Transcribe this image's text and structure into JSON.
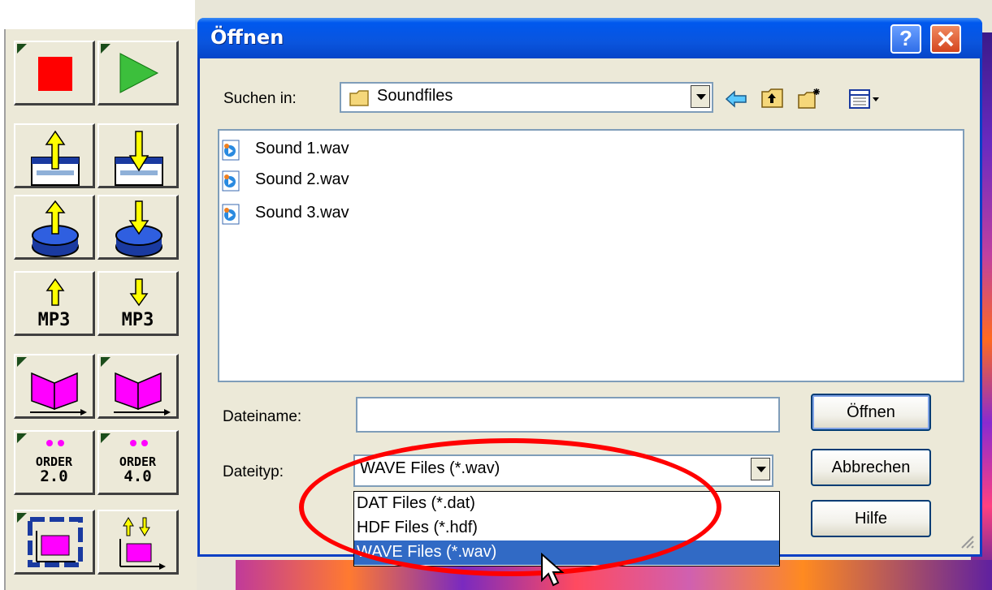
{
  "dialog": {
    "title": "Öffnen",
    "help_button": "?",
    "look_in": {
      "label": "Suchen in:",
      "value": "Soundfiles"
    },
    "files": [
      {
        "name": "Sound 1.wav",
        "icon": "wav-file-icon"
      },
      {
        "name": "Sound 2.wav",
        "icon": "wav-file-icon"
      },
      {
        "name": "Sound 3.wav",
        "icon": "wav-file-icon"
      }
    ],
    "filename": {
      "label": "Dateiname:",
      "value": ""
    },
    "filetype": {
      "label": "Dateityp:",
      "value": "WAVE Files (*.wav)",
      "options": [
        "DAT Files (*.dat)",
        "HDF Files (*.hdf)",
        "WAVE Files (*.wav)"
      ],
      "selected_index": 2
    },
    "buttons": {
      "open": "Öffnen",
      "cancel": "Abbrechen",
      "help": "Hilfe"
    }
  },
  "toolbar": {
    "buttons": [
      {
        "name": "stop",
        "icon": "stop-icon"
      },
      {
        "name": "play",
        "icon": "play-icon"
      },
      {
        "name": "export-window",
        "icon": "window-up-arrow-icon"
      },
      {
        "name": "import-window",
        "icon": "window-down-arrow-icon"
      },
      {
        "name": "export-disk",
        "icon": "disk-up-arrow-icon"
      },
      {
        "name": "import-disk",
        "icon": "disk-down-arrow-icon"
      },
      {
        "name": "export-mp3",
        "label": "MP3"
      },
      {
        "name": "import-mp3",
        "label": "MP3"
      },
      {
        "name": "book-1",
        "icon": "book-icon"
      },
      {
        "name": "book-2",
        "icon": "book-icon"
      },
      {
        "name": "order-2",
        "label": "ORDER",
        "value": "2.0"
      },
      {
        "name": "order-4",
        "label": "ORDER",
        "value": "4.0"
      },
      {
        "name": "chart-1",
        "icon": "chart-frame-icon"
      },
      {
        "name": "chart-2",
        "icon": "chart-arrows-icon"
      }
    ]
  },
  "colors": {
    "title_bar": "#0a55de",
    "selection": "#316ac5",
    "highlight_circle": "#ff0000"
  }
}
